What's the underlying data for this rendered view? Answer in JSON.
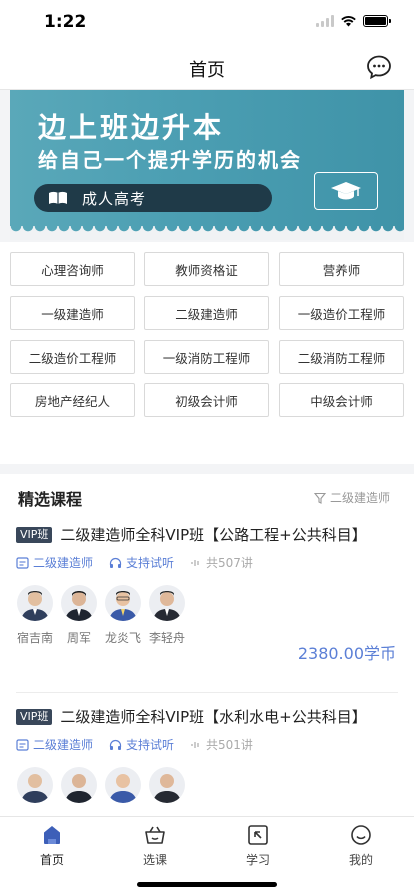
{
  "status": {
    "time": "1:22"
  },
  "nav": {
    "title": "首页",
    "message_icon": "chat-bubble-icon"
  },
  "banner": {
    "line1": "边上班边升本",
    "line2": "给自己一个提升学历的机会",
    "pill_text": "成人高考",
    "colors": {
      "bg": "#4c9fb3",
      "pill": "#1f3a48"
    }
  },
  "categories": [
    [
      "心理咨询师",
      "教师资格证",
      "营养师"
    ],
    [
      "一级建造师",
      "二级建造师",
      "一级造价工程师"
    ],
    [
      "二级造价工程师",
      "一级消防工程师",
      "二级消防工程师"
    ],
    [
      "房地产经纪人",
      "初级会计师",
      "中级会计师"
    ]
  ],
  "section": {
    "title": "精选课程",
    "filter_label": "二级建造师"
  },
  "courses": [
    {
      "badge": "VIP班",
      "title": "二级建造师全科VIP班【公路工程+公共科目】",
      "category": "二级建造师",
      "audition": "支持试听",
      "lessons": "共507讲",
      "teachers": [
        "宿吉南",
        "周军",
        "龙炎飞",
        "李轻舟"
      ],
      "price": "2380.00学币"
    },
    {
      "badge": "VIP班",
      "title": "二级建造师全科VIP班【水利水电+公共科目】",
      "category": "二级建造师",
      "audition": "支持试听",
      "lessons": "共501讲"
    }
  ],
  "tabs": [
    "首页",
    "选课",
    "学习",
    "我的"
  ],
  "colors": {
    "accent": "#5b7fd6",
    "vip_badge": "#39475a"
  }
}
